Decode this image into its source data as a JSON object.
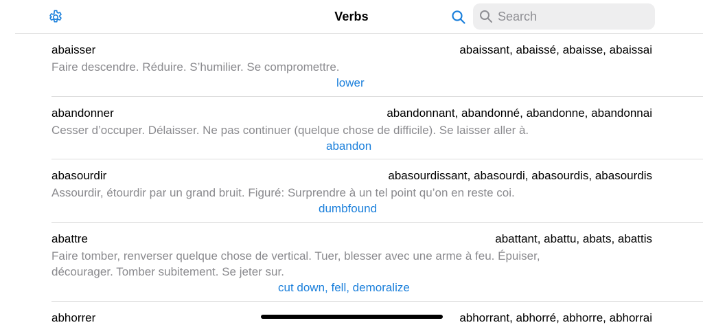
{
  "header": {
    "title": "Verbs",
    "search_placeholder": "Search"
  },
  "colors": {
    "accent": "#1a7fdb",
    "definition": "#8a8a8e",
    "search_bg": "#eeeeef"
  },
  "entries": [
    {
      "verb": "abaisser",
      "forms": "abaissant, abaissé, abaisse, abaissai",
      "definition": "Faire descendre. Réduire. S’humilier. Se compromettre.",
      "translation": "lower"
    },
    {
      "verb": "abandonner",
      "forms": "abandonnant, abandonné, abandonne, abandonnai",
      "definition": "Cesser d’occuper. Délaisser. Ne pas continuer (quelque chose de difficile). Se laisser aller à.",
      "translation": "abandon"
    },
    {
      "verb": "abasourdir",
      "forms": "abasourdissant, abasourdi, abasourdis, abasourdis",
      "definition": "Assourdir, étourdir par un grand bruit. Figuré: Surprendre à un tel point qu’on en reste coi.",
      "translation": "dumbfound"
    },
    {
      "verb": "abattre",
      "forms": "abattant, abattu, abats, abattis",
      "definition": "Faire tomber, renverser quelque chose de vertical. Tuer, blesser avec une arme à feu. Épuiser, décourager. Tomber subitement. Se jeter sur.",
      "translation": "cut down, fell, demoralize"
    },
    {
      "verb": "abhorrer",
      "forms": "abhorrant, abhorré, abhorre, abhorrai",
      "definition": "",
      "translation": ""
    }
  ]
}
